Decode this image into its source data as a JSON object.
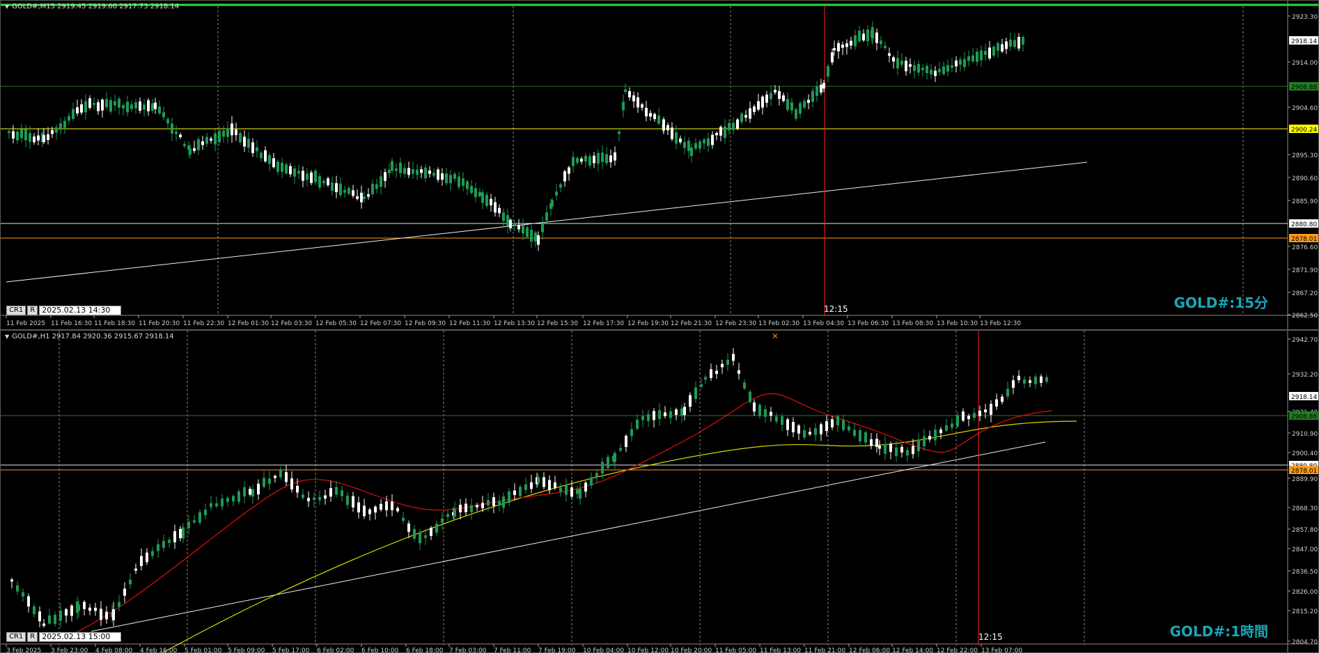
{
  "colors": {
    "background": "#000000",
    "bull": "#1f9a55",
    "bear": "#ffffff",
    "grid": "#8a8a8a",
    "axis_text": "#d0d0d0",
    "hline_green": "#1e7f1e",
    "hline_yellow": "#ffff00",
    "hline_white": "#e8e8e8",
    "hline_orange": "#ff9a1a",
    "vline_red": "#ff2020",
    "ma_red": "#e01010",
    "ma_yellow": "#d8d800",
    "trendline": "#f0f0f0",
    "watermark": "#1aa6b7"
  },
  "top_chart": {
    "header": "GOLD#,M15  2919.45 2919.66 2917.73 2918.14",
    "watermark": "GOLD#:15分",
    "cursor_cr": "CR1",
    "cursor_r": "R",
    "cursor_date": "2025.02.13 14:30",
    "vline_label": "12:15",
    "price_labels": [
      "2923.30",
      "2914.00",
      "2904.60",
      "2895.30",
      "2890.60",
      "2885.90",
      "2876.60",
      "2871.90",
      "2867.20",
      "2862.50"
    ],
    "special_labels": {
      "bid": "2918.14",
      "green": "2908.88",
      "yellow": "2900.24",
      "white": "2880.80",
      "orange": "2878.01"
    },
    "time_labels": [
      "11 Feb 2025",
      "11 Feb 16:30",
      "11 Feb 18:30",
      "11 Feb 20:30",
      "11 Feb 22:30",
      "12 Feb 01:30",
      "12 Feb 03:30",
      "12 Feb 05:30",
      "12 Feb 07:30",
      "12 Feb 09:30",
      "12 Feb 11:30",
      "12 Feb 13:30",
      "12 Feb 15:30",
      "12 Feb 17:30",
      "12 Feb 19:30",
      "12 Feb 21:30",
      "12 Feb 23:30",
      "13 Feb 02:30",
      "13 Feb 04:30",
      "13 Feb 06:30",
      "13 Feb 08:30",
      "13 Feb 10:30",
      "13 Feb 12:30"
    ]
  },
  "bottom_chart": {
    "header": "GOLD#,H1  2917.84 2920.36 2915.67 2918.14",
    "watermark": "GOLD#:1時間",
    "cursor_cr": "CR1",
    "cursor_r": "R",
    "cursor_date": "2025.02.13 15:00",
    "vline_label": "12:15",
    "price_labels": [
      "2942.70",
      "2932.20",
      "2921.40",
      "2910.90",
      "2900.40",
      "2889.90",
      "2868.30",
      "2857.80",
      "2847.00",
      "2836.50",
      "2826.00",
      "2815.20",
      "2804.70"
    ],
    "special_labels": {
      "bid": "2918.14",
      "green": "2908.88",
      "white": "2880.80",
      "orange": "2878.01"
    },
    "time_labels": [
      "3 Feb 2025",
      "3 Feb 23:00",
      "4 Feb 08:00",
      "4 Feb 16:00",
      "5 Feb 01:00",
      "5 Feb 09:00",
      "5 Feb 17:00",
      "6 Feb 02:00",
      "6 Feb 10:00",
      "6 Feb 18:00",
      "7 Feb 03:00",
      "7 Feb 11:00",
      "7 Feb 19:00",
      "10 Feb 04:00",
      "10 Feb 12:00",
      "10 Feb 20:00",
      "11 Feb 05:00",
      "11 Feb 13:00",
      "11 Feb 21:00",
      "12 Feb 06:00",
      "12 Feb 14:00",
      "12 Feb 22:00",
      "13 Feb 07:00"
    ]
  }
}
